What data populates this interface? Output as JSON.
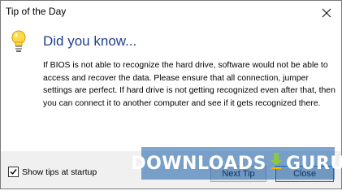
{
  "window": {
    "title": "Tip of the Day",
    "close_icon": "close-icon"
  },
  "tip": {
    "icon": "lightbulb-icon",
    "heading": "Did you know...",
    "text": "If BIOS is not able to recognize the hard drive, software would not be able to access and recover the data. Please ensure that all connection, jumper settings are perfect. If hard drive is not getting recognized even after that, then you can connect it to another computer and see if it gets recognized there."
  },
  "footer": {
    "show_tips_label": "Show tips at startup",
    "show_tips_checked": true,
    "next_tip_label": "Next Tip",
    "close_label": "Close"
  },
  "watermark": {
    "left": "DOWNLOADS",
    "right": "GURU"
  },
  "colors": {
    "heading": "#1f3f8f",
    "footer_bg": "#f0f0f0",
    "close_button_border": "#0078d7"
  }
}
